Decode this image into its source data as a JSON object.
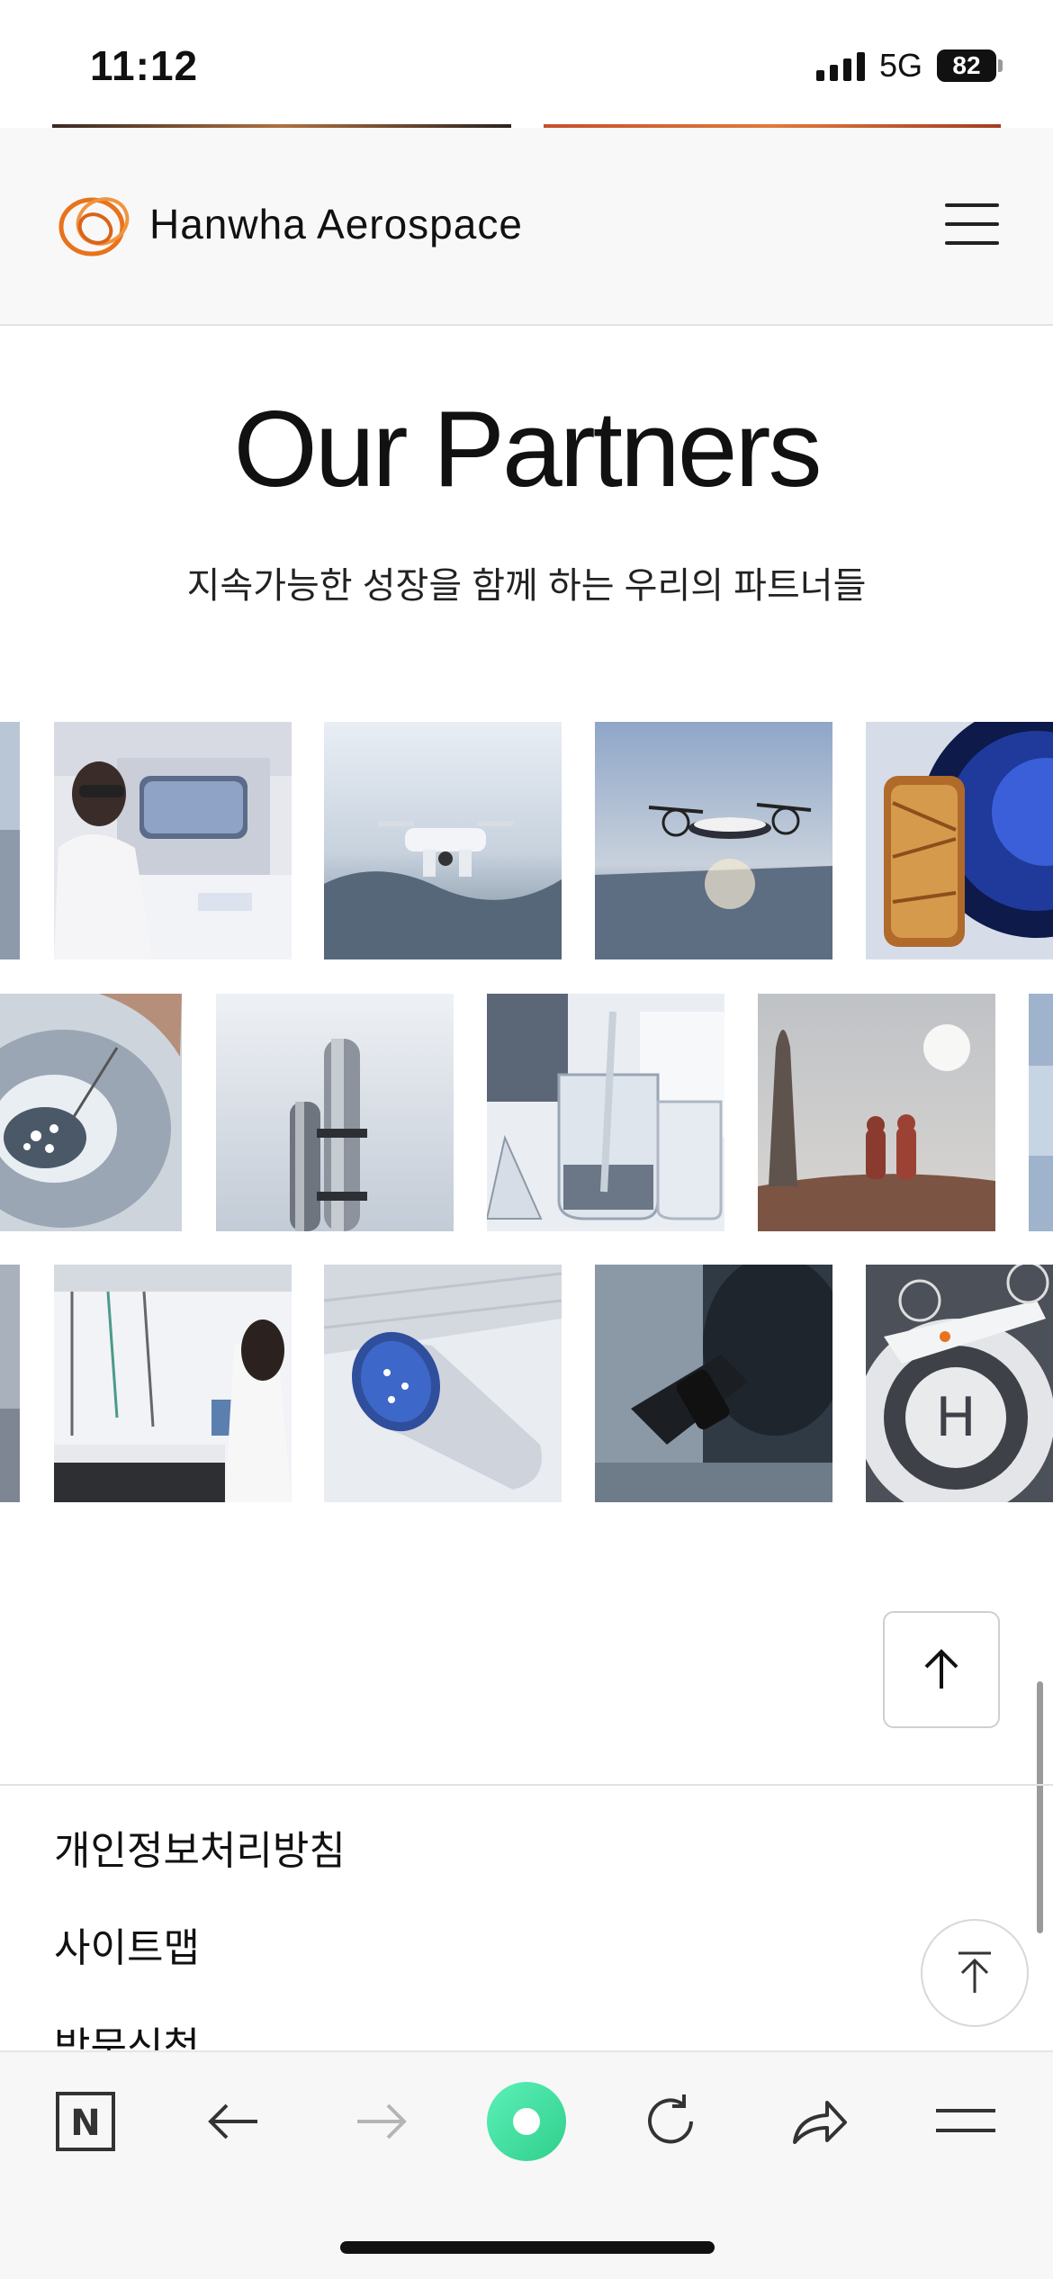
{
  "status_bar": {
    "time": "11:12",
    "network": "5G",
    "battery": "82"
  },
  "header": {
    "brand": "Hanwha Aerospace",
    "menu_icon": "hamburger-menu-icon"
  },
  "section": {
    "title": "Our Partners",
    "subtitle": "지속가능한 성장을 함께 하는 우리의 파트너들"
  },
  "gallery": {
    "rows": [
      [
        "scientist in lab with goggles",
        "drone over water",
        "air taxi over city",
        "gold-foil satellite part"
      ],
      [
        "petri dish with tweezers",
        "rocket fuel tanks",
        "lab glassware",
        "astronauts near rocket on mars"
      ],
      [
        "lab technician with equipment",
        "jet engine in factory",
        "person looking through microscope",
        "eVTOL on landing pad"
      ]
    ]
  },
  "buttons": {
    "scroll_top_icon": "arrow-up-icon",
    "floating_top_icon": "arrow-to-top-icon"
  },
  "footer": {
    "links": [
      "개인정보처리방침",
      "사이트맵",
      "방문신청"
    ]
  },
  "browser_toolbar": {
    "icons": [
      "naver-n-icon",
      "back-arrow-icon",
      "forward-arrow-icon",
      "green-dot-icon",
      "reload-icon",
      "share-icon",
      "menu-icon"
    ]
  },
  "colors": {
    "brand_orange": "#e8731c",
    "accent_green": "#3ddca0"
  }
}
